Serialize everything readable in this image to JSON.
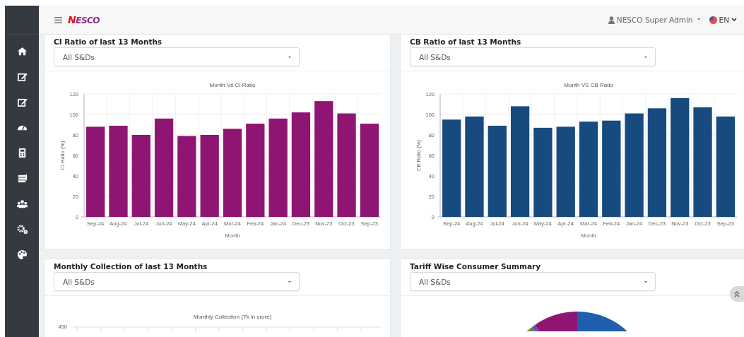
{
  "topbar": {
    "logo": "NESCO",
    "user": "NESCO Super Admin",
    "language": "EN"
  },
  "cards": [
    {
      "kind": "bar",
      "title": "CI Ratio of last 13 Months",
      "select": {
        "value": "All S&Ds"
      },
      "chart_data": {
        "type": "bar",
        "title": "Month Vs CI Ratio",
        "xlabel": "Month",
        "ylabel": "CI Ratio (%)",
        "categories": [
          "Sep-24",
          "Aug-24",
          "Jul-24",
          "Jun-24",
          "May-24",
          "Apr-24",
          "Mar-24",
          "Feb-24",
          "Jan-24",
          "Dec-23",
          "Nov-23",
          "Oct-23",
          "Sep-23"
        ],
        "series": [
          {
            "color": "#8e1672",
            "values": [
              88,
              89,
              80,
              96,
              79,
              80,
              86,
              91,
              96,
              102,
              113,
              101,
              91
            ]
          }
        ],
        "ylim": [
          0,
          120
        ],
        "yticks": [
          0,
          20,
          40,
          60,
          80,
          100,
          120
        ],
        "grid": true
      }
    },
    {
      "kind": "bar",
      "title": "CB Ratio of last 13 Months",
      "select": {
        "value": "All S&Ds"
      },
      "chart_data": {
        "type": "bar",
        "title": "Month VS CB Ratio",
        "xlabel": "Month",
        "ylabel": "CB Ratio (%)",
        "categories": [
          "Sep-24",
          "Aug-24",
          "Jul-24",
          "Jun-24",
          "May-24",
          "Apr-24",
          "Mar-24",
          "Feb-24",
          "Jan-24",
          "Dec-23",
          "Nov-23",
          "Oct-23",
          "Sep-23"
        ],
        "series": [
          {
            "color": "#174a7e",
            "values": [
              95,
              98,
              89,
              108,
              87,
              88,
              93,
              94,
              101,
              106,
              116,
              107,
              98
            ]
          }
        ],
        "ylim": [
          0,
          120
        ],
        "yticks": [
          0,
          20,
          40,
          60,
          80,
          100,
          120
        ],
        "grid": true
      }
    },
    {
      "kind": "collection",
      "title": "Monthly Collection of last 13 Months",
      "select": {
        "value": "All S&Ds"
      },
      "chart_title": "Monthly Collection (Tk in crore)",
      "ytick_label": "450"
    },
    {
      "kind": "pie",
      "title": "Tariff Wise Consumer Summary",
      "select": {
        "value": "All S&Ds"
      }
    }
  ]
}
